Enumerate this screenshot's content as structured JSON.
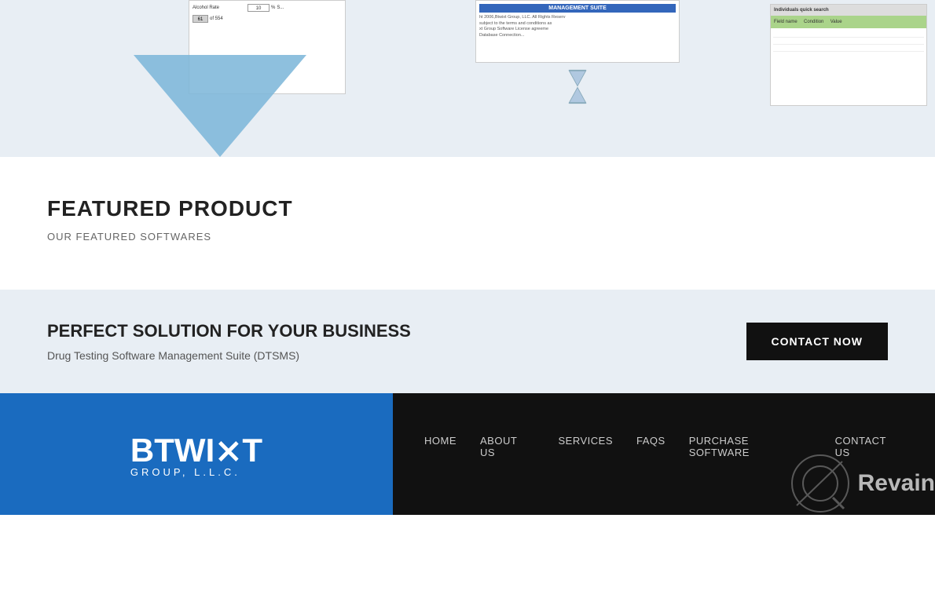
{
  "hero": {
    "screenshot_left": {
      "label": "Alcohol Rate",
      "value": "10",
      "percent": "%",
      "page_label": "S...",
      "page_num": "61",
      "total": "of 554"
    },
    "screenshot_center": {
      "title": "MANAGEMENT SUITE",
      "lines": [
        "ht 2006, Btwixt Group, LLC. All Rights Reserv",
        "subject to the terms and conditions as",
        "xt Group Software License agreeme",
        "Database Connection..."
      ]
    },
    "screenshot_right": {
      "header": "Individuals quick search",
      "green_row": "",
      "columns": [
        "Field name",
        "Condition",
        "Value"
      ]
    }
  },
  "featured": {
    "title": "FEATURED PRODUCT",
    "subtitle": "OUR FEATURED SOFTWARES"
  },
  "cta": {
    "headline": "PERFECT SOLUTION FOR YOUR BUSINESS",
    "subtext": "Drug Testing Software Management Suite (DTSMS)",
    "button_label": "CONTACT NOW"
  },
  "footer": {
    "logo_top": "BTWIXT",
    "logo_bottom": "GROUP, L.L.C.",
    "nav_items": [
      {
        "label": "HOME",
        "id": "home"
      },
      {
        "label": "ABOUT US",
        "id": "about"
      },
      {
        "label": "SERVICES",
        "id": "services"
      },
      {
        "label": "FAQS",
        "id": "faqs"
      },
      {
        "label": "PURCHASE SOFTWARE",
        "id": "purchase"
      },
      {
        "label": "CONTACT US",
        "id": "contact"
      }
    ],
    "revain_text": "Revain"
  }
}
